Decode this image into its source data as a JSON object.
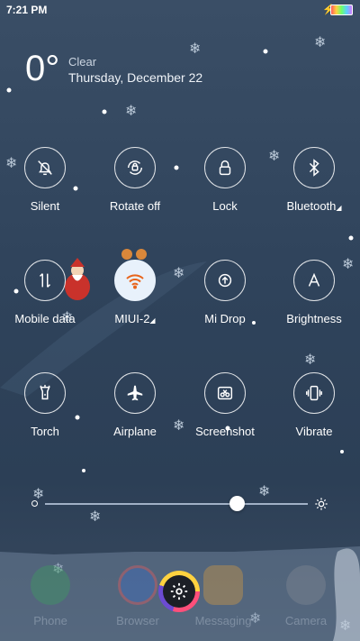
{
  "status_bar": {
    "time": "7:21 PM",
    "charging_icon": "lightning-icon",
    "battery_icon": "battery-rainbow-icon"
  },
  "weather": {
    "temperature": "0°",
    "condition": "Clear",
    "date": "Thursday, December 22"
  },
  "toggles": [
    {
      "label": "Silent",
      "icon": "bell-off-icon",
      "on": false
    },
    {
      "label": "Rotate off",
      "icon": "rotate-lock-icon",
      "on": false
    },
    {
      "label": "Lock",
      "icon": "lock-icon",
      "on": false
    },
    {
      "label": "Bluetooth",
      "icon": "bluetooth-icon",
      "on": false,
      "has_menu": true
    },
    {
      "label": "Mobile data",
      "icon": "mobile-data-icon",
      "on": false
    },
    {
      "label": "MIUI-2",
      "icon": "wifi-icon",
      "on": true,
      "has_menu": true
    },
    {
      "label": "Mi Drop",
      "icon": "upload-icon",
      "on": false
    },
    {
      "label": "Brightness",
      "icon": "brightness-auto-icon",
      "on": false
    },
    {
      "label": "Torch",
      "icon": "flashlight-icon",
      "on": false
    },
    {
      "label": "Airplane",
      "icon": "airplane-icon",
      "on": false
    },
    {
      "label": "Screenshot",
      "icon": "scissors-icon",
      "on": false
    },
    {
      "label": "Vibrate",
      "icon": "vibrate-icon",
      "on": false
    }
  ],
  "brightness": {
    "level": 0.73,
    "min_icon": "brightness-low-icon",
    "max_icon": "brightness-high-icon"
  },
  "dock": [
    {
      "label": "Phone",
      "icon": "phone-icon"
    },
    {
      "label": "Browser",
      "icon": "browser-icon"
    },
    {
      "label": "Messaging",
      "icon": "messaging-icon"
    },
    {
      "label": "Camera",
      "icon": "camera-icon"
    }
  ],
  "settings_button": {
    "icon": "gear-icon"
  },
  "colors": {
    "accent_on": "#e8f1fb",
    "wifi_orange": "#e8641b",
    "background": "#2f435b"
  }
}
